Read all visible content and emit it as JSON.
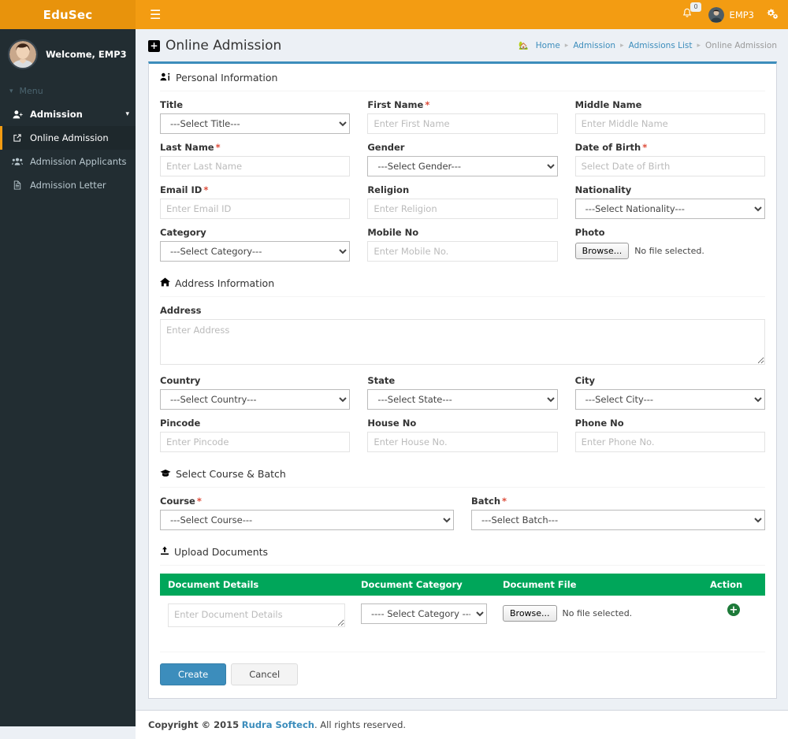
{
  "brand": {
    "name": "EduSec",
    "accent": "#f39c12",
    "panel_accent": "#3c8dbc",
    "table_header": "#00a65a"
  },
  "topbar": {
    "menu_toggle_icon": "hamburger-icon",
    "notifications": {
      "icon": "bell-icon",
      "count": "0"
    },
    "user": {
      "name": "EMP3",
      "avatar": "user-avatar"
    },
    "settings_icon": "gears-icon"
  },
  "sidebar": {
    "welcome": "Welcome, EMP3",
    "menu_label": "Menu",
    "items": [
      {
        "label": "Admission",
        "icon": "user-plus-icon",
        "caret": "chevron-down-icon",
        "active": false,
        "group": true
      },
      {
        "label": "Online Admission",
        "icon": "external-link-icon",
        "active": true,
        "group": false
      },
      {
        "label": "Admission Applicants",
        "icon": "users-icon",
        "active": false,
        "group": false
      },
      {
        "label": "Admission Letter",
        "icon": "file-text-icon",
        "active": false,
        "group": false
      }
    ]
  },
  "header": {
    "title": "Online Admission",
    "title_icon": "plus-square-icon",
    "breadcrumb": {
      "home_icon": "home-icon",
      "items": [
        "Home",
        "Admission",
        "Admissions List"
      ],
      "current": "Online Admission"
    }
  },
  "sections": {
    "personal": {
      "title": "Personal Information",
      "icon": "user-info-icon"
    },
    "address": {
      "title": "Address Information",
      "icon": "home-icon"
    },
    "course": {
      "title": "Select Course & Batch",
      "icon": "graduation-cap-icon"
    },
    "documents": {
      "title": "Upload Documents",
      "icon": "upload-icon"
    }
  },
  "fields": {
    "title": {
      "label": "Title",
      "required": false,
      "type": "select",
      "value": "---Select Title---"
    },
    "first_name": {
      "label": "First Name",
      "required": true,
      "type": "text",
      "placeholder": "Enter First Name"
    },
    "middle_name": {
      "label": "Middle Name",
      "required": false,
      "type": "text",
      "placeholder": "Enter Middle Name"
    },
    "last_name": {
      "label": "Last Name",
      "required": true,
      "type": "text",
      "placeholder": "Enter Last Name"
    },
    "gender": {
      "label": "Gender",
      "required": false,
      "type": "select",
      "value": "---Select Gender---"
    },
    "dob": {
      "label": "Date of Birth",
      "required": true,
      "type": "text",
      "placeholder": "Select Date of Birth"
    },
    "email": {
      "label": "Email ID",
      "required": true,
      "type": "text",
      "placeholder": "Enter Email ID"
    },
    "religion": {
      "label": "Religion",
      "required": false,
      "type": "text",
      "placeholder": "Enter Religion"
    },
    "nationality": {
      "label": "Nationality",
      "required": false,
      "type": "select",
      "value": "---Select Nationality---"
    },
    "category": {
      "label": "Category",
      "required": false,
      "type": "select",
      "value": "---Select Category---"
    },
    "mobile": {
      "label": "Mobile No",
      "required": false,
      "type": "text",
      "placeholder": "Enter Mobile No."
    },
    "photo": {
      "label": "Photo",
      "required": false,
      "type": "file",
      "button": "Browse...",
      "status": "No file selected."
    },
    "address": {
      "label": "Address",
      "required": false,
      "type": "textarea",
      "placeholder": "Enter Address"
    },
    "country": {
      "label": "Country",
      "required": false,
      "type": "select",
      "value": "---Select Country---"
    },
    "state": {
      "label": "State",
      "required": false,
      "type": "select",
      "value": "---Select State---"
    },
    "city": {
      "label": "City",
      "required": false,
      "type": "select",
      "value": "---Select City---"
    },
    "pincode": {
      "label": "Pincode",
      "required": false,
      "type": "text",
      "placeholder": "Enter Pincode"
    },
    "house_no": {
      "label": "House No",
      "required": false,
      "type": "text",
      "placeholder": "Enter House No."
    },
    "phone_no": {
      "label": "Phone No",
      "required": false,
      "type": "text",
      "placeholder": "Enter Phone No."
    },
    "course": {
      "label": "Course",
      "required": true,
      "type": "select",
      "value": "---Select Course---"
    },
    "batch": {
      "label": "Batch",
      "required": true,
      "type": "select",
      "value": "---Select Batch---"
    }
  },
  "documents_table": {
    "columns": [
      "Document Details",
      "Document Category",
      "Document File",
      "Action"
    ],
    "rows": [
      {
        "details_placeholder": "Enter Document Details",
        "category_value": "---- Select Category ----",
        "file_button": "Browse...",
        "file_status": "No file selected.",
        "action_icon": "add-circle-icon"
      }
    ]
  },
  "actions": {
    "create": "Create",
    "cancel": "Cancel"
  },
  "footer": {
    "copyright": "Copyright © 2015",
    "company": "Rudra Softech",
    "rights": ". All rights reserved."
  }
}
